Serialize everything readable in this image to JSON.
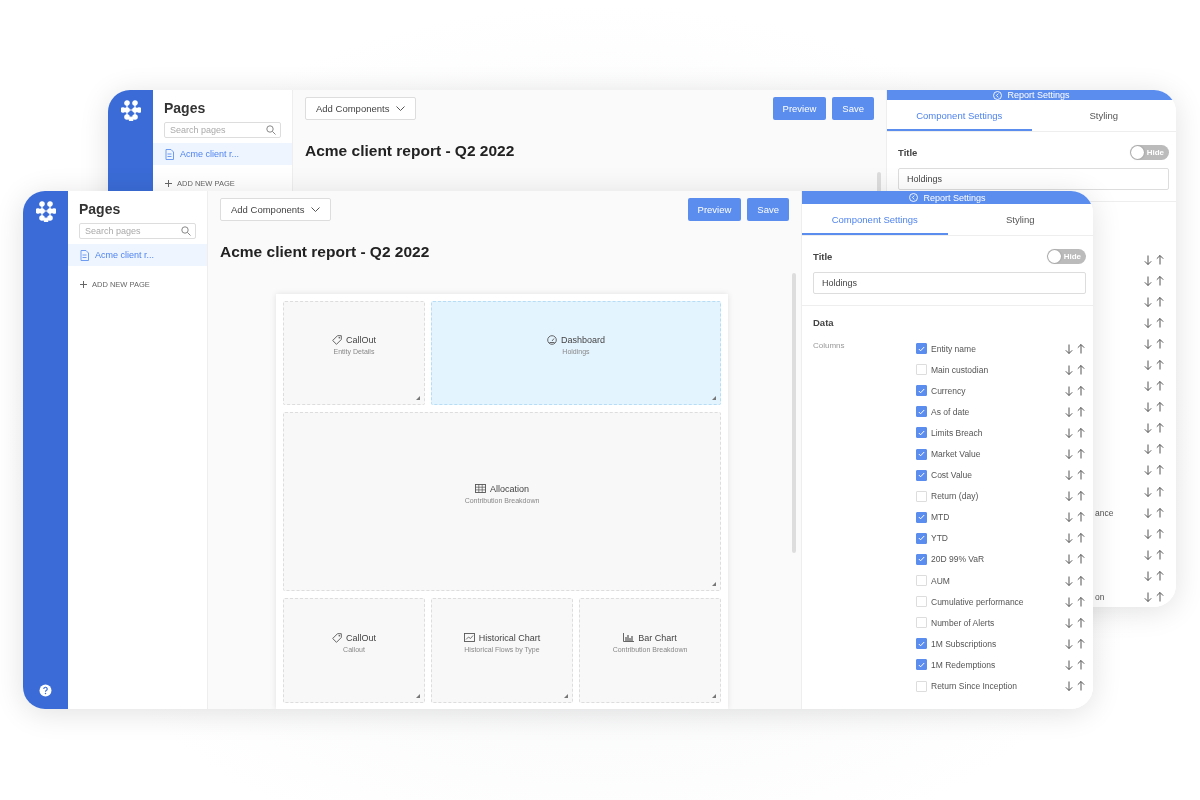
{
  "back_window": {
    "sidebar": {
      "title": "Pages",
      "search": {
        "placeholder": "Search pages"
      },
      "pages": [
        {
          "label": "Acme client r...",
          "selected": true
        }
      ],
      "add_page": "ADD NEW PAGE"
    },
    "toolbar": {
      "add_components": "Add Components",
      "buttons": [
        {
          "label": "Preview",
          "kind": "primary"
        },
        {
          "label": "Save",
          "kind": "primary"
        }
      ]
    },
    "report_title": "Acme client report - Q2 2022",
    "settings": {
      "header": "Report Settings",
      "tabs": [
        {
          "label": "Component Settings",
          "selected": true
        },
        {
          "label": "Styling",
          "selected": false
        }
      ],
      "title_label": "Title",
      "toggle": {
        "label": "Hide",
        "on": false
      },
      "title_value": "Holdings",
      "column_rows": [
        {
          "kind": "arrows"
        },
        {
          "kind": "arrows"
        },
        {
          "kind": "arrows"
        },
        {
          "kind": "arrows"
        },
        {
          "kind": "arrows"
        },
        {
          "kind": "arrows"
        },
        {
          "kind": "arrows"
        },
        {
          "kind": "arrows"
        },
        {
          "kind": "arrows"
        },
        {
          "kind": "arrows"
        },
        {
          "kind": "arrows"
        },
        {
          "kind": "arrows"
        },
        {
          "kind": "fragment",
          "text": "ance"
        },
        {
          "kind": "arrows"
        },
        {
          "kind": "arrows"
        },
        {
          "kind": "arrows"
        },
        {
          "kind": "fragment",
          "text": "on"
        }
      ]
    }
  },
  "front_window": {
    "sidebar": {
      "title": "Pages",
      "search": {
        "placeholder": "Search pages"
      },
      "pages": [
        {
          "label": "Acme client r...",
          "selected": true
        }
      ],
      "add_page": "ADD NEW PAGE"
    },
    "toolbar": {
      "add_components": "Add Components",
      "buttons": [
        {
          "label": "Preview",
          "kind": "primary"
        },
        {
          "label": "Save",
          "kind": "primary"
        }
      ]
    },
    "report_title": "Acme client report - Q2 2022",
    "canvas": {
      "rows": [
        {
          "tiles": [
            {
              "kind": "tag",
              "title": "CallOut",
              "subtitle": "Entity Details",
              "selected": false
            },
            {
              "kind": "gauge",
              "title": "Dashboard",
              "subtitle": "Holdings",
              "selected": true
            }
          ]
        },
        {
          "tiles": [
            {
              "kind": "table",
              "title": "Allocation",
              "subtitle": "Contribution Breakdown",
              "selected": false
            }
          ]
        },
        {
          "tiles": [
            {
              "kind": "tag",
              "title": "CallOut",
              "subtitle": "Callout",
              "selected": false
            },
            {
              "kind": "line-chart",
              "title": "Historical Chart",
              "subtitle": "Historical Flows by Type",
              "selected": false
            },
            {
              "kind": "bar-chart",
              "title": "Bar Chart",
              "subtitle": "Contribution Breakdown",
              "selected": false
            }
          ]
        }
      ]
    },
    "settings": {
      "header": "Report Settings",
      "tabs": [
        {
          "label": "Component Settings",
          "selected": true
        },
        {
          "label": "Styling",
          "selected": false
        }
      ],
      "title_label": "Title",
      "toggle": {
        "label": "Hide",
        "on": false
      },
      "title_value": "Holdings",
      "data_label": "Data",
      "columns_label": "Columns",
      "columns": [
        {
          "label": "Entity name",
          "checked": true
        },
        {
          "label": "Main custodian",
          "checked": false
        },
        {
          "label": "Currency",
          "checked": true
        },
        {
          "label": "As of date",
          "checked": true
        },
        {
          "label": "Limits Breach",
          "checked": true
        },
        {
          "label": "Market Value",
          "checked": true
        },
        {
          "label": "Cost Value",
          "checked": true
        },
        {
          "label": "Return (day)",
          "checked": false
        },
        {
          "label": "MTD",
          "checked": true
        },
        {
          "label": "YTD",
          "checked": true
        },
        {
          "label": "20D 99% VaR",
          "checked": true
        },
        {
          "label": "AUM",
          "checked": false
        },
        {
          "label": "Cumulative performance",
          "checked": false
        },
        {
          "label": "Number of Alerts",
          "checked": false
        },
        {
          "label": "1M Subscriptions",
          "checked": true
        },
        {
          "label": "1M Redemptions",
          "checked": true
        },
        {
          "label": "Return Since Inception",
          "checked": false
        }
      ]
    }
  }
}
